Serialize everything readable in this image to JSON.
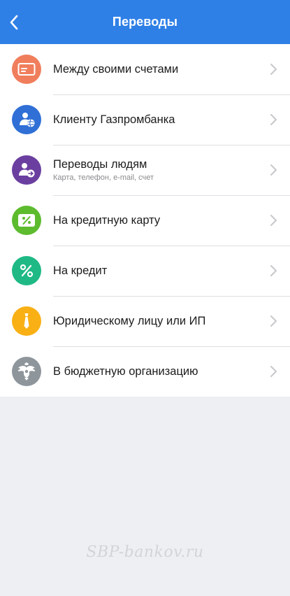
{
  "header": {
    "title": "Переводы",
    "background": "#2f80e6",
    "back_icon": "chevron-left-icon"
  },
  "items": [
    {
      "label": "Между своими счетами",
      "subtitle": "",
      "icon": "card-icon",
      "color": "#f07e5c"
    },
    {
      "label": "Клиенту Газпромбанка",
      "subtitle": "",
      "icon": "client-globe-icon",
      "color": "#2f6fd6"
    },
    {
      "label": "Переводы людям",
      "subtitle": "Карта, телефон, e-mail, счет",
      "icon": "person-transfer-icon",
      "color": "#6b3fa0"
    },
    {
      "label": "На кредитную карту",
      "subtitle": "",
      "icon": "percent-card-icon",
      "color": "#5dbb2e"
    },
    {
      "label": "На кредит",
      "subtitle": "",
      "icon": "percent-icon",
      "color": "#1fb985"
    },
    {
      "label": "Юридическому лицу или ИП",
      "subtitle": "",
      "icon": "tie-icon",
      "color": "#f9b015"
    },
    {
      "label": "В бюджетную организацию",
      "subtitle": "",
      "icon": "coat-of-arms-icon",
      "color": "#8e969c"
    }
  ],
  "watermark": "SBP-bankov.ru",
  "chevron_icon": "chevron-right-icon"
}
